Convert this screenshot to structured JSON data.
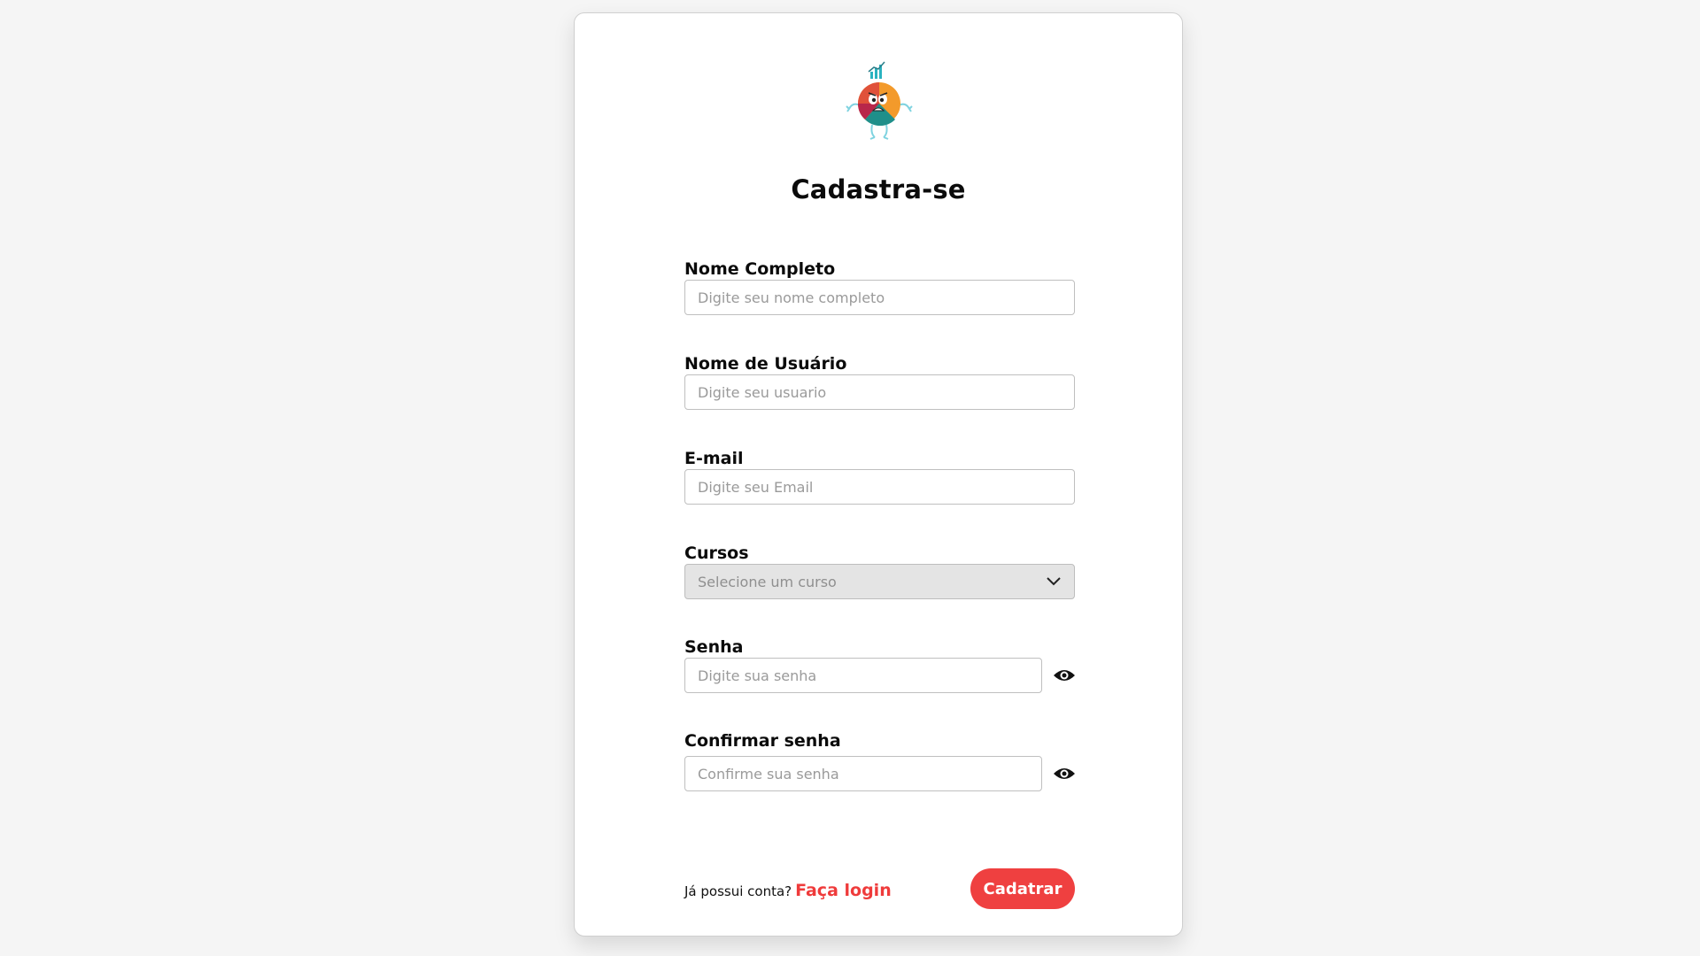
{
  "colors": {
    "accent": "#ef4040",
    "link": "#ef3b3b",
    "background": "#f5f5f5",
    "card": "#ffffff",
    "select_bg": "#e4e4e4"
  },
  "logo": {
    "icon": "mascot-logo-icon"
  },
  "title": "Cadastra-se",
  "fields": {
    "full_name": {
      "label": "Nome Completo",
      "placeholder": "Digite seu nome completo",
      "value": ""
    },
    "username": {
      "label": "Nome de Usuário",
      "placeholder": "Digite seu usuario",
      "value": ""
    },
    "email": {
      "label": "E-mail",
      "placeholder": "Digite seu Email",
      "value": ""
    },
    "course": {
      "label": "Cursos",
      "selected": "Selecione um curso",
      "icon": "chevron-down-icon"
    },
    "password": {
      "label": "Senha",
      "placeholder": "Digite sua senha",
      "value": "",
      "icon": "eye-icon"
    },
    "confirm_password": {
      "label": "Confirmar senha",
      "placeholder": "Confirme sua senha",
      "value": "",
      "icon": "eye-icon"
    }
  },
  "footer": {
    "question": "Já possui conta?",
    "login_link": "Faça login",
    "submit_label": "Cadatrar"
  }
}
